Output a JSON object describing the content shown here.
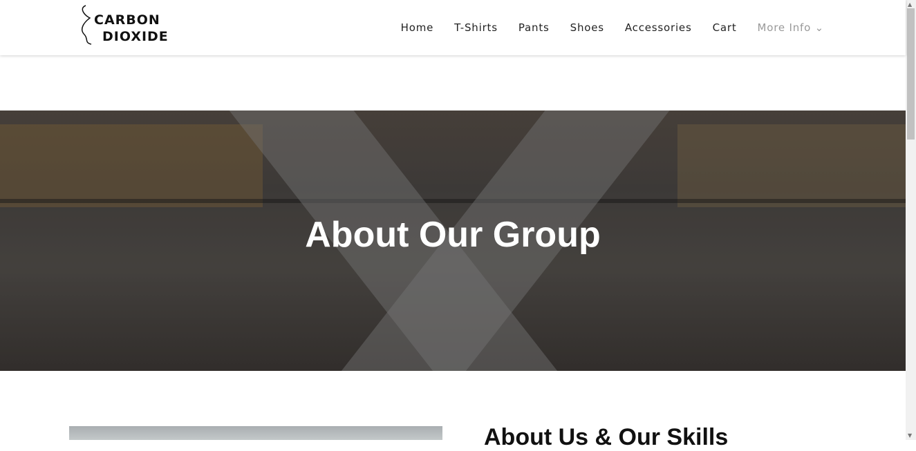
{
  "brand": {
    "line1": "CARBON",
    "line2": "DIOXIDE"
  },
  "nav": {
    "items": [
      {
        "label": "Home"
      },
      {
        "label": "T-Shirts"
      },
      {
        "label": "Pants"
      },
      {
        "label": "Shoes"
      },
      {
        "label": "Accessories"
      },
      {
        "label": "Cart"
      },
      {
        "label": "More Info ⌄"
      }
    ]
  },
  "hero": {
    "title": "About Our Group"
  },
  "about": {
    "heading": "About Us & Our Skills"
  },
  "scroll": {
    "up": "▲",
    "down": "▼"
  }
}
